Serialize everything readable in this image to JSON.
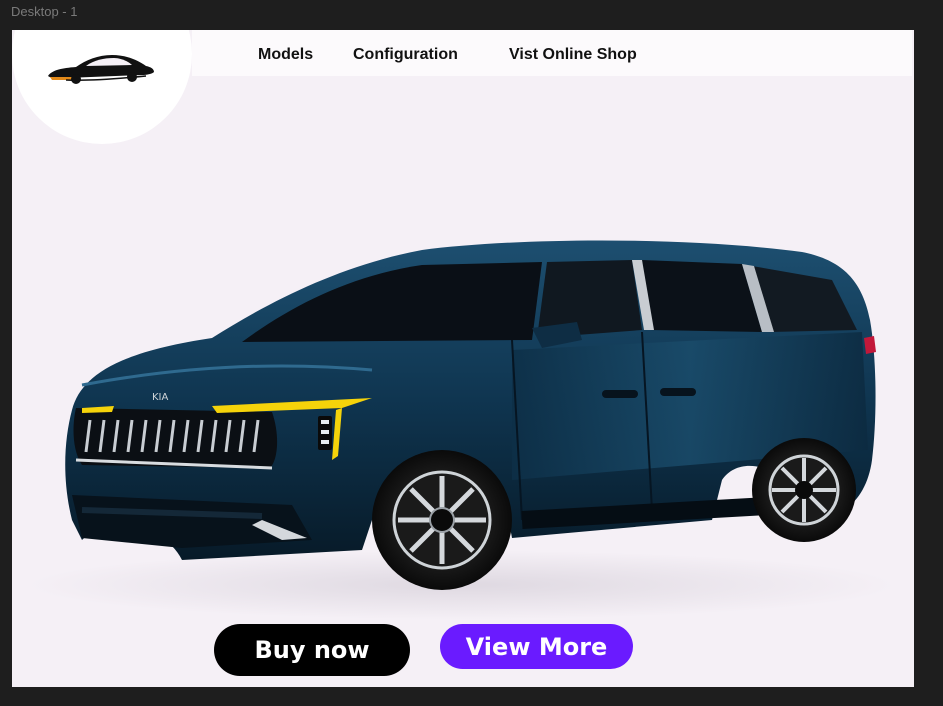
{
  "canvas": {
    "frame_label": "Desktop - 1"
  },
  "header": {
    "logo_icon": "car-silhouette-icon",
    "nav": {
      "models": "Models",
      "configuration": "Configuration",
      "shop": "Vist Online Shop"
    }
  },
  "hero": {
    "image": "dark-blue-minivan-icon",
    "body_color": "#0f3550",
    "headlight_color": "#f5d30a"
  },
  "actions": {
    "buy_label": "Buy now",
    "view_label": "View More"
  },
  "colors": {
    "frame_bg": "#f5f0f6",
    "canvas_bg": "#1e1e1e",
    "buy_bg": "#000000",
    "view_bg": "#6a1bff"
  }
}
